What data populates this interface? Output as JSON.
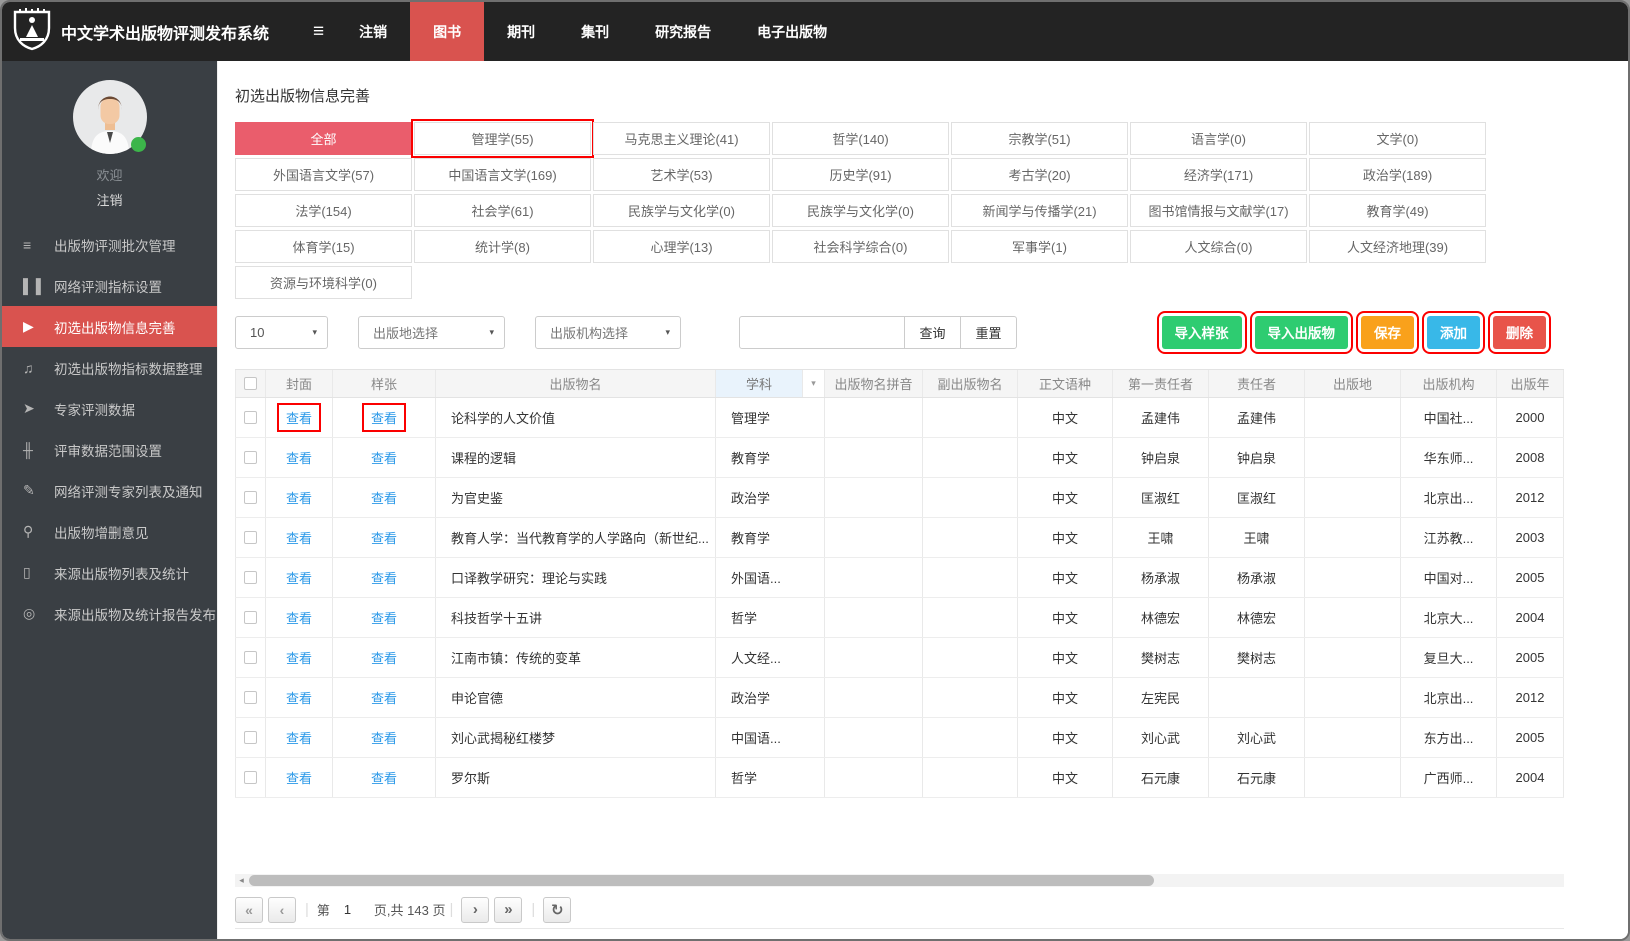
{
  "colors": {
    "navbar_bg": "#232323",
    "sidebar_bg": "#3a3f44",
    "accent_red": "#d9534f",
    "category_active": "#ea5d6c",
    "link_blue": "#2b99e8",
    "annotation_red": "#fb0000",
    "subject_header_bg": "#e9f3fc"
  },
  "navbar": {
    "title": "中文学术出版物评测发布系统",
    "burger_icon": "≡",
    "items": [
      {
        "name": "nav-tab-logout",
        "label": "注销",
        "active": false
      },
      {
        "name": "nav-tab-books",
        "label": "图书",
        "active": true
      },
      {
        "name": "nav-tab-journals",
        "label": "期刊",
        "active": false
      },
      {
        "name": "nav-tab-collections",
        "label": "集刊",
        "active": false
      },
      {
        "name": "nav-tab-research-reports",
        "label": "研究报告",
        "active": false
      },
      {
        "name": "nav-tab-epublications",
        "label": "电子出版物",
        "active": false
      }
    ]
  },
  "sidebar": {
    "welcome": "欢迎",
    "logout": "注销",
    "items": [
      {
        "name": "sidebar-item-batch-management",
        "icon": "list-icon",
        "glyph": "≡",
        "label": "出版物评测批次管理",
        "active": false
      },
      {
        "name": "sidebar-item-network-index-settings",
        "icon": "columns-icon",
        "glyph": "▌▐",
        "label": "网络评测指标设置",
        "active": false
      },
      {
        "name": "sidebar-item-preselection-info",
        "icon": "play-circle-icon",
        "glyph": "▶",
        "label": "初选出版物信息完善",
        "active": true
      },
      {
        "name": "sidebar-item-index-data-organize",
        "icon": "music-note-icon",
        "glyph": "♫",
        "label": "初选出版物指标数据整理",
        "active": false
      },
      {
        "name": "sidebar-item-expert-evaluation-data",
        "icon": "send-icon",
        "glyph": "➤",
        "label": "专家评测数据",
        "active": false
      },
      {
        "name": "sidebar-item-review-data-scope",
        "icon": "sliders-icon",
        "glyph": "╫",
        "label": "评审数据范围设置",
        "active": false
      },
      {
        "name": "sidebar-item-expert-list-notice",
        "icon": "paperclip-icon",
        "glyph": "✎",
        "label": "网络评测专家列表及通知",
        "active": false
      },
      {
        "name": "sidebar-item-add-delete-opinions",
        "icon": "magnifier-icon",
        "glyph": "⚲",
        "label": "出版物增删意见",
        "active": false
      },
      {
        "name": "sidebar-item-source-list-stats",
        "icon": "book-icon",
        "glyph": "▯",
        "label": "来源出版物列表及统计",
        "active": false
      },
      {
        "name": "sidebar-item-source-report-publish",
        "icon": "eye-icon",
        "glyph": "◎",
        "label": "来源出版物及统计报告发布",
        "active": false
      }
    ]
  },
  "page": {
    "title": "初选出版物信息完善"
  },
  "categories": [
    {
      "label": "全部",
      "active": true,
      "highlighted": false
    },
    {
      "label": "管理学(55)",
      "active": false,
      "highlighted": true
    },
    {
      "label": "马克思主义理论(41)"
    },
    {
      "label": "哲学(140)"
    },
    {
      "label": "宗教学(51)"
    },
    {
      "label": "语言学(0)"
    },
    {
      "label": "文学(0)"
    },
    {
      "label": "外国语言文学(57)"
    },
    {
      "label": "中国语言文学(169)"
    },
    {
      "label": "艺术学(53)"
    },
    {
      "label": "历史学(91)"
    },
    {
      "label": "考古学(20)"
    },
    {
      "label": "经济学(171)"
    },
    {
      "label": "政治学(189)"
    },
    {
      "label": "法学(154)"
    },
    {
      "label": "社会学(61)"
    },
    {
      "label": "民族学与文化学(0)"
    },
    {
      "label": "民族学与文化学(0)"
    },
    {
      "label": "新闻学与传播学(21)"
    },
    {
      "label": "图书馆情报与文献学(17)"
    },
    {
      "label": "教育学(49)"
    },
    {
      "label": "体育学(15)"
    },
    {
      "label": "统计学(8)"
    },
    {
      "label": "心理学(13)"
    },
    {
      "label": "社会科学综合(0)"
    },
    {
      "label": "军事学(1)"
    },
    {
      "label": "人文综合(0)"
    },
    {
      "label": "人文经济地理(39)"
    },
    {
      "label": "资源与环境科学(0)"
    }
  ],
  "toolbar": {
    "page_size": "10",
    "caret_icon": "▾",
    "place_select": "出版地选择",
    "org_select": "出版机构选择",
    "search_value": "",
    "query_label": "查询",
    "reset_label": "重置",
    "actions": [
      {
        "name": "import-sample-button",
        "label": "导入样张",
        "color": "#2ecc71"
      },
      {
        "name": "import-publication-button",
        "label": "导入出版物",
        "color": "#2ecc71"
      },
      {
        "name": "save-button",
        "label": "保存",
        "color": "#f9a11b"
      },
      {
        "name": "add-button",
        "label": "添加",
        "color": "#38b8e8"
      },
      {
        "name": "delete-button",
        "label": "删除",
        "color": "#e8544a"
      }
    ]
  },
  "table": {
    "headers": [
      "封面",
      "样张",
      "出版物名",
      "学科",
      "出版物名拼音",
      "副出版物名",
      "正文语种",
      "第一责任者",
      "责任者",
      "出版地",
      "出版机构",
      "出版年"
    ],
    "subject_filter_icon": "▾",
    "view_label": "查看",
    "rows": [
      {
        "title": "论科学的人文价值",
        "subject": "管理学",
        "pinyin": "",
        "sub_title": "",
        "language": "中文",
        "first_author": "孟建伟",
        "author": "孟建伟",
        "place": "",
        "publisher": "中国社...",
        "year": "2000",
        "boxed": true
      },
      {
        "title": "课程的逻辑",
        "subject": "教育学",
        "pinyin": "",
        "sub_title": "",
        "language": "中文",
        "first_author": "钟启泉",
        "author": "钟启泉",
        "place": "",
        "publisher": "华东师...",
        "year": "2008"
      },
      {
        "title": "为官史鉴",
        "subject": "政治学",
        "pinyin": "",
        "sub_title": "",
        "language": "中文",
        "first_author": "匡淑红",
        "author": "匡淑红",
        "place": "",
        "publisher": "北京出...",
        "year": "2012"
      },
      {
        "title": "教育人学：当代教育学的人学路向（新世纪...",
        "subject": "教育学",
        "pinyin": "",
        "sub_title": "",
        "language": "中文",
        "first_author": "王啸",
        "author": "王啸",
        "place": "",
        "publisher": "江苏教...",
        "year": "2003"
      },
      {
        "title": "口译教学研究：理论与实践",
        "subject": "外国语...",
        "pinyin": "",
        "sub_title": "",
        "language": "中文",
        "first_author": "杨承淑",
        "author": "杨承淑",
        "place": "",
        "publisher": "中国对...",
        "year": "2005"
      },
      {
        "title": "科技哲学十五讲",
        "subject": "哲学",
        "pinyin": "",
        "sub_title": "",
        "language": "中文",
        "first_author": "林德宏",
        "author": "林德宏",
        "place": "",
        "publisher": "北京大...",
        "year": "2004"
      },
      {
        "title": "江南市镇：传统的变革",
        "subject": "人文经...",
        "pinyin": "",
        "sub_title": "",
        "language": "中文",
        "first_author": "樊树志",
        "author": "樊树志",
        "place": "",
        "publisher": "复旦大...",
        "year": "2005"
      },
      {
        "title": "申论官德",
        "subject": "政治学",
        "pinyin": "",
        "sub_title": "",
        "language": "中文",
        "first_author": "左宪民",
        "author": "",
        "place": "",
        "publisher": "北京出...",
        "year": "2012"
      },
      {
        "title": "刘心武揭秘红楼梦",
        "subject": "中国语...",
        "pinyin": "",
        "sub_title": "",
        "language": "中文",
        "first_author": "刘心武",
        "author": "刘心武",
        "place": "",
        "publisher": "东方出...",
        "year": "2005"
      },
      {
        "title": "罗尔斯",
        "subject": "哲学",
        "pinyin": "",
        "sub_title": "",
        "language": "中文",
        "first_author": "石元康",
        "author": "石元康",
        "place": "",
        "publisher": "广西师...",
        "year": "2004"
      }
    ]
  },
  "scrollbar": {
    "left_arrow_icon": "◂"
  },
  "pagination": {
    "first_icon": "«",
    "prev_icon": "‹",
    "label_page": "第",
    "current_page": "1",
    "label_total": "页,共 143 页",
    "next_icon": "›",
    "last_icon": "»",
    "refresh_icon": "↻"
  }
}
